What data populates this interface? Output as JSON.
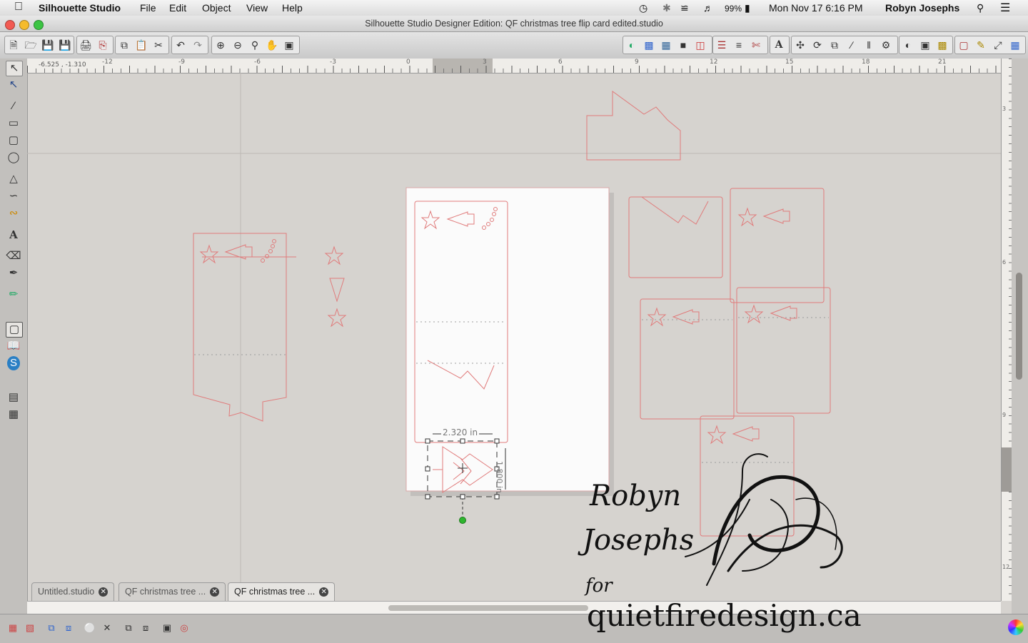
{
  "menubar": {
    "app_name": "Silhouette Studio",
    "menus": [
      "File",
      "Edit",
      "Object",
      "View",
      "Help"
    ],
    "battery": "99%",
    "datetime": "Mon Nov 17  6:16 PM",
    "user": "Robyn Josephs"
  },
  "window": {
    "title": "Silhouette Studio Designer Edition: QF christmas tree flip card edited.studio"
  },
  "ruler": {
    "cursor_readout": "-6.525 , -1.310",
    "ticks": [
      "-12",
      "-9",
      "-6",
      "-3",
      "0",
      "3",
      "6",
      "9",
      "12",
      "15",
      "18",
      "21"
    ],
    "v_ticks": [
      "3",
      "6",
      "9",
      "12",
      "15"
    ]
  },
  "selection": {
    "width_label": "2.320 in",
    "height_label": "1.800 in"
  },
  "tabs": [
    {
      "label": "Untitled.studio"
    },
    {
      "label": "QF christmas tree ..."
    },
    {
      "label": "QF christmas tree ..."
    }
  ],
  "watermark": {
    "line1": "Robyn",
    "line2": "Josephs",
    "line3": "for",
    "site": "quietfiredesign.ca"
  },
  "colors": {
    "cut_line": "#e07b7b",
    "canvas_bg": "#d6d3cf",
    "rotate_handle": "#2fb52f"
  }
}
